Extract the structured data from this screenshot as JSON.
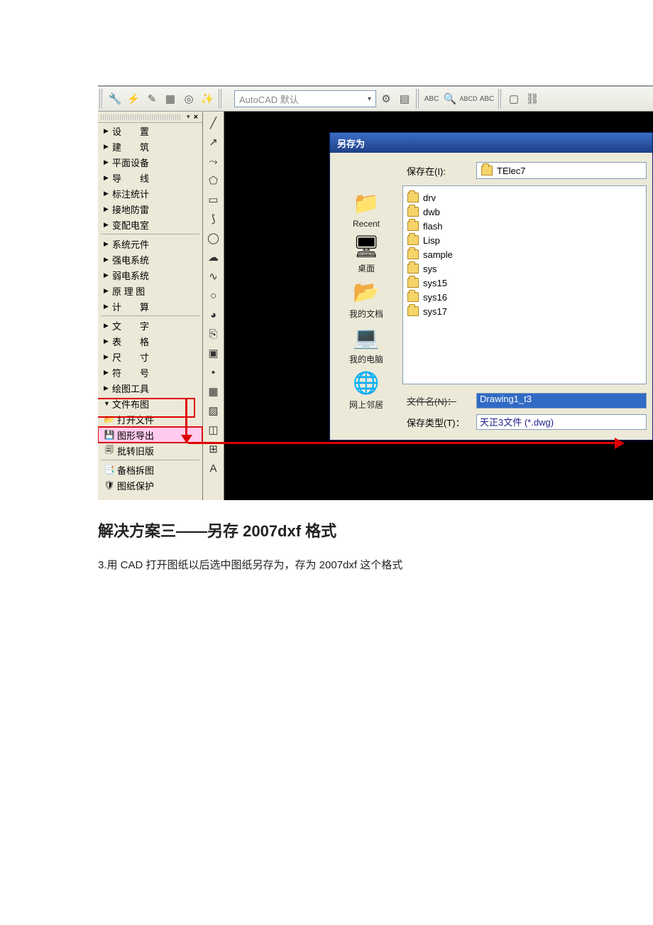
{
  "toolbar": {
    "layer_text": "AutoCAD 默认"
  },
  "tree": {
    "items1": [
      {
        "label": "设　　置"
      },
      {
        "label": "建　　筑"
      },
      {
        "label": "平面设备"
      },
      {
        "label": "导　　线"
      },
      {
        "label": "标注统计"
      },
      {
        "label": "接地防雷"
      },
      {
        "label": "变配电室"
      }
    ],
    "items2": [
      {
        "label": "系统元件"
      },
      {
        "label": "强电系统"
      },
      {
        "label": "弱电系统"
      },
      {
        "label": "原 理 图"
      },
      {
        "label": "计　　算"
      }
    ],
    "items3": [
      {
        "label": "文　　字"
      },
      {
        "label": "表　　格"
      },
      {
        "label": "尺　　寸"
      },
      {
        "label": "符　　号"
      },
      {
        "label": "绘图工具"
      }
    ],
    "file_layout": "文件布图",
    "open_file": "打开文件",
    "export": "图形导出",
    "batch": "批转旧版",
    "archive": "备档拆图",
    "protect": "图纸保护"
  },
  "dialog": {
    "title": "另存为",
    "save_in_label": "保存在(I):",
    "save_in_value": "TElec7",
    "places": [
      {
        "id": "recent",
        "label": "Recent"
      },
      {
        "id": "desktop",
        "label": "桌面"
      },
      {
        "id": "mydocs",
        "label": "我的文档"
      },
      {
        "id": "mypc",
        "label": "我的电脑"
      },
      {
        "id": "network",
        "label": "网上邻居"
      }
    ],
    "files": [
      "drv",
      "dwb",
      "flash",
      "Lisp",
      "sample",
      "sys",
      "sys15",
      "sys16",
      "sys17"
    ],
    "filename_label": "文件名(N)：",
    "filename_value": "Drawing1_t3",
    "filetype_label": "保存类型(T)：",
    "filetype_value": "天正3文件 (*.dwg)"
  },
  "doc": {
    "heading": "解决方案三——另存 2007dxf 格式",
    "body": "3.用 CAD 打开图纸以后选中图纸另存为，存为 2007dxf 这个格式"
  }
}
